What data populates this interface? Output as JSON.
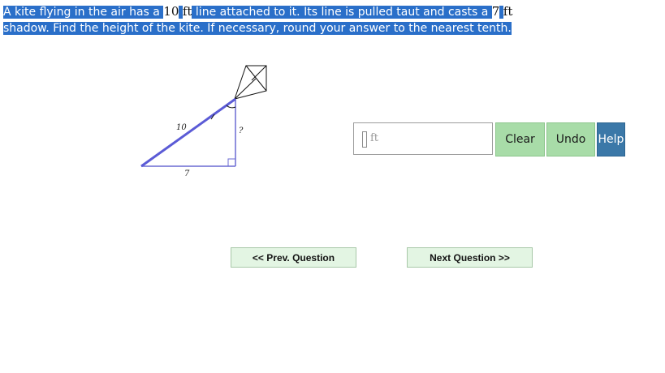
{
  "question": {
    "part1": "A kite flying in the air has a ",
    "line_length": "10",
    "dash1": " ",
    "unit1": "ft",
    "part2": " line attached to it. Its line is pulled taut and casts a ",
    "shadow_length": "7",
    "dash2": " ",
    "unit2": "ft",
    "part3": "shadow. Find the height of the kite. If necessary, round your answer to the nearest tenth."
  },
  "diagram": {
    "hypotenuse_label": "10",
    "base_label": "7",
    "height_label": "?"
  },
  "answer": {
    "value": "",
    "unit": "ft"
  },
  "buttons": {
    "clear": "Clear",
    "undo": "Undo",
    "help": "Help"
  },
  "nav": {
    "prev": "<< Prev. Question",
    "next": "Next Question >>"
  },
  "colors": {
    "highlight": "#2a6fc9",
    "kite_line": "#5b5bd6",
    "button_green": "#a8dca8",
    "button_blue": "#3b78a8",
    "nav_bg": "#e3f5e3"
  }
}
